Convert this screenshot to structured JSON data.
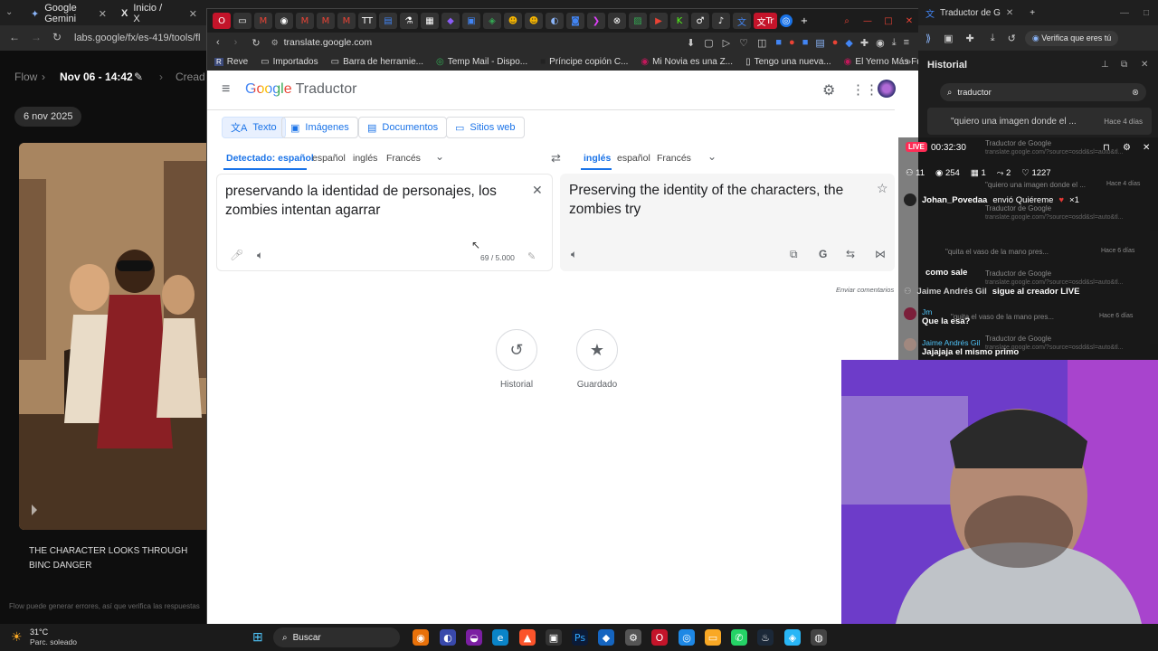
{
  "bg_browser": {
    "tabs": [
      {
        "label": "Google Gemini"
      },
      {
        "label": "Inicio / X"
      }
    ],
    "url": "labs.google/fx/es-419/tools/fl"
  },
  "flow": {
    "logo": "Flow",
    "project": "Nov 06 - 14:42",
    "crumb": "Cread",
    "date": "6 nov 2025",
    "caption": "THE CHARACTER LOOKS THROUGH BINC DANGER",
    "footer": "Flow puede generar errores, así que verifica las respuestas"
  },
  "window": {
    "tab_label": "Tr",
    "url": "translate.google.com",
    "bookmarks": [
      {
        "label": "Reve"
      },
      {
        "label": "Importados"
      },
      {
        "label": "Barra de herramie..."
      },
      {
        "label": "Temp Mail - Dispo..."
      },
      {
        "label": "Príncipe copión C..."
      },
      {
        "label": "Mi Novia es una Z..."
      },
      {
        "label": "Tengo una nueva..."
      },
      {
        "label": "El Yerno Más Fuer..."
      }
    ]
  },
  "translate": {
    "logo_google": "Google",
    "logo_product": "Traductor",
    "modes": [
      {
        "label": "Texto"
      },
      {
        "label": "Imágenes"
      },
      {
        "label": "Documentos"
      },
      {
        "label": "Sitios web"
      }
    ],
    "source_langs": [
      {
        "label": "Detectado: español"
      },
      {
        "label": "español"
      },
      {
        "label": "inglés"
      },
      {
        "label": "Francés"
      }
    ],
    "target_langs": [
      {
        "label": "inglés"
      },
      {
        "label": "español"
      },
      {
        "label": "Francés"
      }
    ],
    "source_text": "preservando la identidad de personajes, los zombies intentan agarrar",
    "target_text": "Preserving the identity of the characters, the zombies try",
    "char_count": "69 / 5.000",
    "feedback": "Enviar comentarios",
    "history_label": "Historial",
    "saved_label": "Guardado"
  },
  "sidebar": {
    "badge": "Verifica que eres tú",
    "title": "Historial",
    "search_value": "traductor",
    "items": [
      {
        "title": "\"quiero una imagen donde el ...",
        "time": "Hace 4 días"
      },
      {
        "title": "Traductor de Google",
        "sub": "translate.google.com/?source=osdd&sl=auto&tl..."
      },
      {
        "title": "\"quiero una imagen donde el ...",
        "time": "Hace 4 días"
      },
      {
        "title": "Traductor de Google",
        "sub": "translate.google.com/?source=osdd&sl=auto&tl..."
      },
      {
        "title": "\"quita el vaso de la mano pres...",
        "time": "Hace 6 días"
      },
      {
        "title": "Traductor de Google",
        "sub": "translate.google.com/?source=osdd&sl=auto&tl..."
      },
      {
        "title": "\"quita el vaso de la mano pres...",
        "time": "Hace 6 días"
      },
      {
        "title": "Traductor de Google",
        "sub": "translate.google.com/?source=osdd&sl=auto&tl..."
      }
    ]
  },
  "live": {
    "badge": "LIVE",
    "timer": "00:32:30",
    "stats": {
      "users": "11",
      "views": "254",
      "gifts": "1",
      "shares": "2",
      "likes": "1227"
    },
    "chat": [
      {
        "user": "Johan_Povedaa",
        "text": "envió Quiéreme",
        "extra": "×1"
      },
      {
        "user": "",
        "text": "como sale"
      },
      {
        "user": "Jaime Andrés Gil",
        "text": "sigue al creador LIVE"
      },
      {
        "user": "Jm",
        "text": "Que la esa?"
      },
      {
        "user": "Jaime Andrés Gil",
        "text": "Jajajaja el mismo primo"
      }
    ]
  },
  "taskbar": {
    "weather_temp": "31°C",
    "weather_desc": "Parc. soleado",
    "search": "Buscar"
  }
}
